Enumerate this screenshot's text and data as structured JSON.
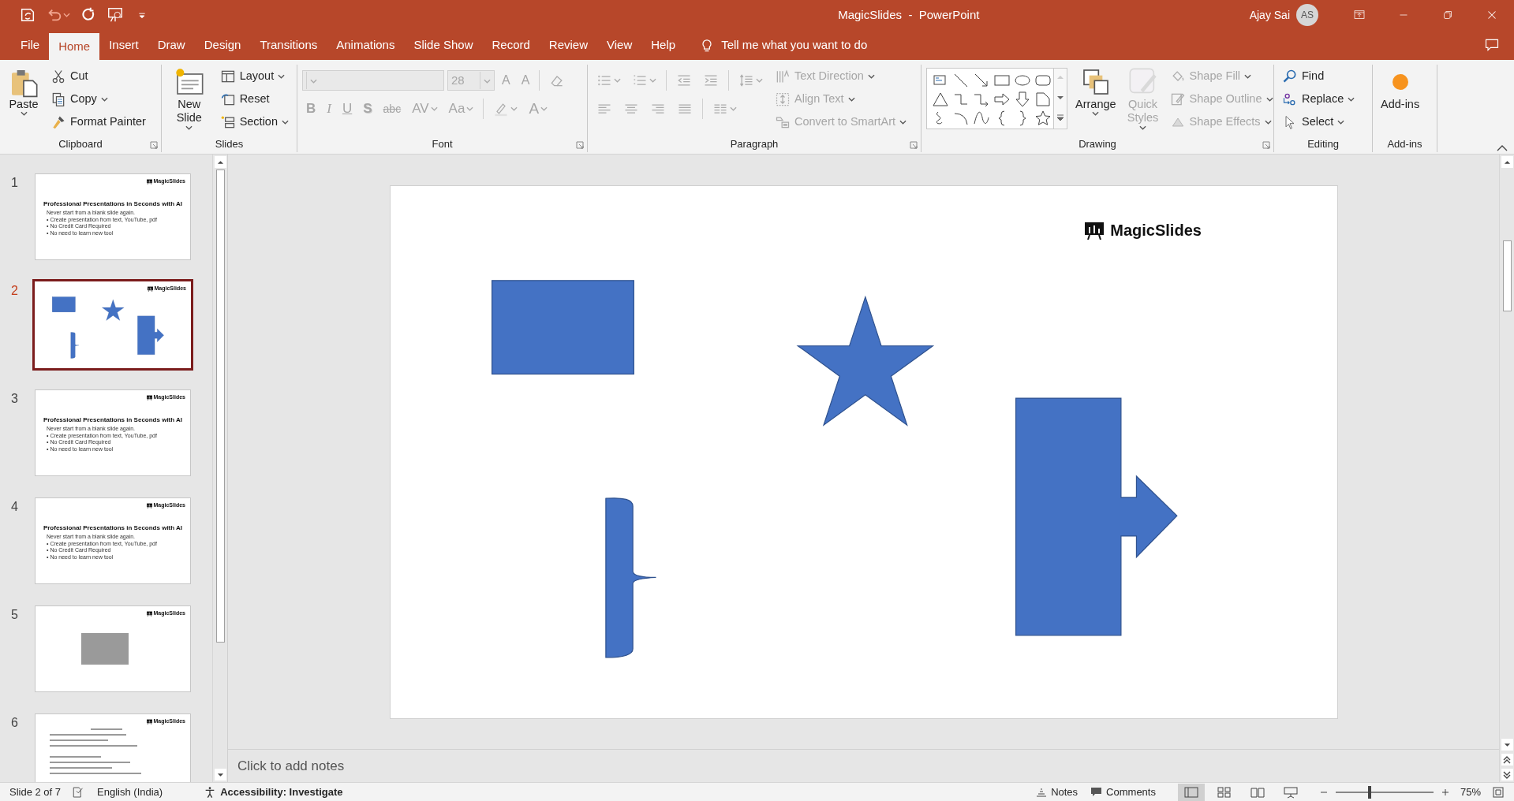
{
  "window": {
    "title": "MagicSlides  -  PowerPoint",
    "user": "Ajay Sai",
    "avatar": "AS"
  },
  "quick_access": [
    {
      "kind": "autosave"
    },
    {
      "kind": "undo"
    },
    {
      "kind": "repeat"
    },
    {
      "kind": "present"
    },
    {
      "kind": "customize"
    }
  ],
  "tabs": [
    {
      "label": "File",
      "selected": false
    },
    {
      "label": "Home",
      "selected": true
    },
    {
      "label": "Insert",
      "selected": false
    },
    {
      "label": "Draw",
      "selected": false
    },
    {
      "label": "Design",
      "selected": false
    },
    {
      "label": "Transitions",
      "selected": false
    },
    {
      "label": "Animations",
      "selected": false
    },
    {
      "label": "Slide Show",
      "selected": false
    },
    {
      "label": "Record",
      "selected": false
    },
    {
      "label": "Review",
      "selected": false
    },
    {
      "label": "View",
      "selected": false
    },
    {
      "label": "Help",
      "selected": false
    }
  ],
  "tell_me": "Tell me what you want to do",
  "ribbon": [
    {
      "label": "Clipboard",
      "launcher": true,
      "columns": [
        {
          "kind": "big",
          "item": {
            "kind": "paste",
            "label": "Paste",
            "dropdown": true
          }
        },
        {
          "kind": "stack",
          "items": [
            {
              "kind": "cut",
              "label": "Cut"
            },
            {
              "kind": "copy",
              "label": "Copy",
              "dropdown": true
            },
            {
              "kind": "painter",
              "label": "Format Painter"
            }
          ]
        }
      ]
    },
    {
      "label": "Slides",
      "columns": [
        {
          "kind": "big",
          "item": {
            "kind": "newslide",
            "label": "New Slide",
            "dropdown": true
          }
        },
        {
          "kind": "stack",
          "items": [
            {
              "kind": "layout",
              "label": "Layout",
              "dropdown": true
            },
            {
              "kind": "reset",
              "label": "Reset"
            },
            {
              "kind": "section",
              "label": "Section",
              "dropdown": true
            }
          ]
        }
      ]
    },
    {
      "label": "Font",
      "launcher": true,
      "columns": [
        {
          "kind": "toolbars",
          "toolbars": [
            {
              "buttons": [
                {
                  "kind": "font-field",
                  "disabled": true
                },
                {
                  "kind": "size-field",
                  "value": "28",
                  "disabled": true
                },
                {
                  "kind": "grow",
                  "glyph": "A",
                  "disabled": true
                },
                {
                  "kind": "shrink",
                  "glyph": "A",
                  "disabled": true
                },
                {
                  "kind": "sep"
                },
                {
                  "kind": "clear",
                  "disabled": true
                }
              ]
            },
            {
              "buttons": [
                {
                  "kind": "bold",
                  "glyph": "B",
                  "disabled": true
                },
                {
                  "kind": "italic",
                  "glyph": "I",
                  "disabled": true
                },
                {
                  "kind": "underline",
                  "glyph": "U",
                  "disabled": true
                },
                {
                  "kind": "shadow",
                  "glyph": "S",
                  "disabled": true
                },
                {
                  "kind": "strike",
                  "glyph": "abc",
                  "disabled": true
                },
                {
                  "kind": "plain",
                  "glyph": "AV",
                  "disabled": true,
                  "dropdown": true
                },
                {
                  "kind": "plain",
                  "glyph": "Aa",
                  "disabled": true,
                  "dropdown": true
                },
                {
                  "kind": "sep"
                },
                {
                  "kind": "highlight",
                  "disabled": true,
                  "dropdown": true
                },
                {
                  "kind": "big",
                  "glyph": "A",
                  "disabled": true,
                  "dropdown": true
                }
              ]
            }
          ]
        }
      ]
    },
    {
      "label": "Paragraph",
      "launcher": true,
      "columns": [
        {
          "kind": "toolbars",
          "toolbars": [
            {
              "buttons": [
                {
                  "kind": "bullets",
                  "disabled": true,
                  "dropdown": true
                },
                {
                  "kind": "numbering",
                  "disabled": true,
                  "dropdown": true
                },
                {
                  "kind": "sep"
                },
                {
                  "kind": "outdent",
                  "disabled": true
                },
                {
                  "kind": "indent",
                  "disabled": true
                },
                {
                  "kind": "sep"
                },
                {
                  "kind": "spacing",
                  "disabled": true,
                  "dropdown": true
                }
              ]
            },
            {
              "buttons": [
                {
                  "kind": "left",
                  "disabled": true
                },
                {
                  "kind": "center",
                  "disabled": true
                },
                {
                  "kind": "right",
                  "disabled": true
                },
                {
                  "kind": "justify",
                  "disabled": true
                },
                {
                  "kind": "sep"
                },
                {
                  "kind": "columns",
                  "disabled": true,
                  "dropdown": true
                }
              ]
            }
          ]
        },
        {
          "kind": "stack",
          "items": [
            {
              "kind": "textdir",
              "label": "Text Direction",
              "dropdown": true,
              "disabled": true
            },
            {
              "kind": "aligntext",
              "label": "Align Text",
              "dropdown": true,
              "disabled": true
            },
            {
              "kind": "smartart",
              "label": "Convert to SmartArt",
              "dropdown": true,
              "disabled": true
            }
          ]
        }
      ]
    },
    {
      "label": "Drawing",
      "launcher": true,
      "columns": [
        {
          "kind": "gallery"
        },
        {
          "kind": "big",
          "item": {
            "kind": "arrange",
            "label": "Arrange",
            "dropdown": true
          }
        },
        {
          "kind": "big",
          "item": {
            "kind": "quickstyles",
            "label": "Quick Styles",
            "dropdown": true,
            "disabled": true
          }
        },
        {
          "kind": "stack",
          "items": [
            {
              "kind": "fill",
              "label": "Shape Fill",
              "dropdown": true,
              "disabled": true
            },
            {
              "kind": "outline",
              "label": "Shape Outline",
              "dropdown": true,
              "disabled": true
            },
            {
              "kind": "effects",
              "label": "Shape Effects",
              "dropdown": true,
              "disabled": true
            }
          ]
        }
      ]
    },
    {
      "label": "Editing",
      "columns": [
        {
          "kind": "stack",
          "items": [
            {
              "kind": "find",
              "label": "Find"
            },
            {
              "kind": "replace",
              "label": "Replace",
              "dropdown": true
            },
            {
              "kind": "select",
              "label": "Select",
              "dropdown": true
            }
          ]
        }
      ]
    },
    {
      "label": "Add-ins",
      "columns": [
        {
          "kind": "big",
          "item": {
            "kind": "addins",
            "label": "Add-ins"
          }
        }
      ]
    }
  ],
  "thumbnails": [
    {
      "number": "1",
      "selected": false,
      "kind": "text",
      "logo": "MagicSlides",
      "title": "Professional Presentations in Seconds with AI",
      "lines": [
        "Never start from a blank slide again.",
        "• Create presentation from text, YouTube, pdf",
        "• No Credit Card Required",
        "• No need to learn new tool"
      ]
    },
    {
      "number": "2",
      "selected": true,
      "kind": "shapes",
      "logo": "MagicSlides"
    },
    {
      "number": "3",
      "selected": false,
      "kind": "text",
      "logo": "MagicSlides",
      "title": "Professional Presentations in Seconds with AI",
      "lines": [
        "Never start from a blank slide again.",
        "• Create presentation from text, YouTube, pdf",
        "• No Credit Card Required",
        "• No need to learn new tool"
      ]
    },
    {
      "number": "4",
      "selected": false,
      "kind": "text",
      "logo": "MagicSlides",
      "title": "Professional Presentations in Seconds with AI",
      "lines": [
        "Never start from a blank slide again.",
        "• Create presentation from text, YouTube, pdf",
        "• No Credit Card Required",
        "• No need to learn new tool"
      ]
    },
    {
      "number": "5",
      "selected": false,
      "kind": "photo",
      "logo": "MagicSlides"
    },
    {
      "number": "6",
      "selected": false,
      "kind": "document",
      "logo": "MagicSlides"
    }
  ],
  "slide": {
    "logo": "MagicSlides",
    "shapes": [
      {
        "kind": "rectangle"
      },
      {
        "kind": "star"
      },
      {
        "kind": "bracket"
      },
      {
        "kind": "arrow-callout"
      }
    ]
  },
  "notes_placeholder": "Click to add notes",
  "status_bar": {
    "slide": "Slide 2 of 7",
    "language": "English (India)",
    "accessibility": "Accessibility: Investigate",
    "notes": "Notes",
    "comments": "Comments",
    "views": [
      {
        "kind": "normal",
        "selected": true
      },
      {
        "kind": "sorter",
        "selected": false
      },
      {
        "kind": "reading",
        "selected": false
      },
      {
        "kind": "slideshow",
        "selected": false
      }
    ],
    "zoom": {
      "label": "75%",
      "level": 0.35
    }
  }
}
